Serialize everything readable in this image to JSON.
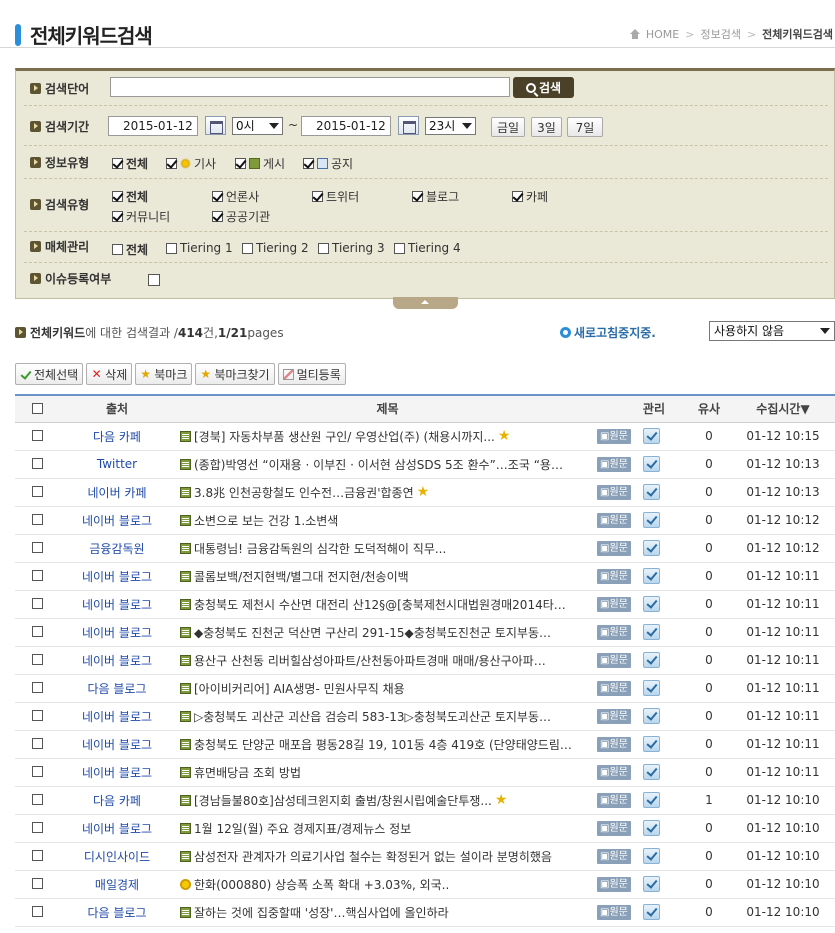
{
  "header": {
    "title": "전체키워드검색",
    "breadcrumb": [
      "HOME",
      "정보검색",
      "전체키워드검색"
    ]
  },
  "search": {
    "keyword_label": "검색단어",
    "keyword_value": "",
    "search_button": "검색",
    "period_label": "검색기간",
    "date_from": "2015-01-12",
    "hour_from": "0시",
    "tilde": "~",
    "date_to": "2015-01-12",
    "hour_to": "23시",
    "quick_buttons": [
      "금일",
      "3일",
      "7일"
    ],
    "info_type_label": "정보유형",
    "info_types": [
      {
        "label": "전체",
        "checked": true,
        "icon": "none"
      },
      {
        "label": "기사",
        "checked": true,
        "icon": "sun-icon"
      },
      {
        "label": "게시",
        "checked": true,
        "icon": "post-icon"
      },
      {
        "label": "공지",
        "checked": true,
        "icon": "notice-icon"
      }
    ],
    "search_type_label": "검색유형",
    "search_types": [
      {
        "label": "전체",
        "checked": true
      },
      {
        "label": "언론사",
        "checked": true
      },
      {
        "label": "트위터",
        "checked": true
      },
      {
        "label": "블로그",
        "checked": true
      },
      {
        "label": "카페",
        "checked": true
      },
      {
        "label": "커뮤니티",
        "checked": true
      },
      {
        "label": "공공기관",
        "checked": true
      }
    ],
    "media_label": "매체관리",
    "media_types": [
      {
        "label": "전체",
        "checked": false
      },
      {
        "label": "Tiering 1",
        "checked": false
      },
      {
        "label": "Tiering 2",
        "checked": false
      },
      {
        "label": "Tiering 3",
        "checked": false
      },
      {
        "label": "Tiering 4",
        "checked": false
      }
    ],
    "issue_label": "이슈등록여부",
    "issue_checked": false
  },
  "results": {
    "prefix": "전체키워드",
    "middle": "에 대한 검색결과 / ",
    "count": "414",
    "count_unit": " 건, ",
    "page": "1/21",
    "page_unit": " pages",
    "refresh_label": "새로고침중지중.",
    "refresh_option": "사용하지 않음"
  },
  "toolbar": {
    "select_all": "전체선택",
    "delete": "삭제",
    "bookmark": "북마크",
    "find_bookmark": "북마크찾기",
    "multi_register": "멀티등록"
  },
  "table": {
    "headers": {
      "source": "출처",
      "title": "제목",
      "manage": "관리",
      "similar": "유사",
      "time": "수집시간▼"
    },
    "original_label": "원문",
    "rows": [
      {
        "source": "다음 카페",
        "title": "[경북] 자동차부품 생산원 구인/ 우영산업(주) (채용시까지...",
        "icon": "post",
        "star": true,
        "similar": "0",
        "time": "01-12 10:15"
      },
      {
        "source": "Twitter",
        "title": "(종합)박영선 “이재용 · 이부진 · 이서현 삼성SDS 5조 환수”…조국 “용…",
        "icon": "post",
        "star": false,
        "similar": "0",
        "time": "01-12 10:13"
      },
      {
        "source": "네이버 카페",
        "title": "3.8兆 인천공항철도 인수전…금융권'합종연",
        "icon": "post",
        "star": true,
        "similar": "0",
        "time": "01-12 10:13"
      },
      {
        "source": "네이버 블로그",
        "title": "소변으로 보는 건강 1.소변색",
        "icon": "post",
        "star": false,
        "similar": "0",
        "time": "01-12 10:12"
      },
      {
        "source": "금융감독원",
        "title": "대통령님! 금융감독원의 심각한 도덕적해이 직무...",
        "icon": "post",
        "star": false,
        "similar": "0",
        "time": "01-12 10:12"
      },
      {
        "source": "네이버 블로그",
        "title": "콜롬보백/전지현백/별그대 전지현/천송이백",
        "icon": "post",
        "star": false,
        "similar": "0",
        "time": "01-12 10:11"
      },
      {
        "source": "네이버 블로그",
        "title": "충청북도 제천시 수산면 대전리 산12§@[충북제천시대법원경매2014타…",
        "icon": "post",
        "star": false,
        "similar": "0",
        "time": "01-12 10:11"
      },
      {
        "source": "네이버 블로그",
        "title": "◆충청북도 진천군 덕산면 구산리 291-15◆충청북도진천군 토지부동…",
        "icon": "post",
        "star": false,
        "similar": "0",
        "time": "01-12 10:11"
      },
      {
        "source": "네이버 블로그",
        "title": "용산구 산천동 리버힐삼성아파트/산천동아파트경매 매매/용산구아파…",
        "icon": "post",
        "star": false,
        "similar": "0",
        "time": "01-12 10:11"
      },
      {
        "source": "다음 블로그",
        "title": "[아이비커리어] AIA생명- 민원사무직 채용",
        "icon": "post",
        "star": false,
        "similar": "0",
        "time": "01-12 10:11"
      },
      {
        "source": "네이버 블로그",
        "title": "▷충청북도 괴산군 괴산읍 검승리 583-13▷충청북도괴산군 토지부동…",
        "icon": "post",
        "star": false,
        "similar": "0",
        "time": "01-12 10:11"
      },
      {
        "source": "네이버 블로그",
        "title": "충청북도 단양군 매포읍 평동28길 19, 101동 4층 419호 (단양태양드림…",
        "icon": "post",
        "star": false,
        "similar": "0",
        "time": "01-12 10:11"
      },
      {
        "source": "네이버 블로그",
        "title": "휴면배당금 조회 방법",
        "icon": "post",
        "star": false,
        "similar": "0",
        "time": "01-12 10:11"
      },
      {
        "source": "다음 카페",
        "title": "[경남들불80호]삼성테크윈지회 출범/창원시립예술단투쟁...",
        "icon": "post",
        "star": true,
        "similar": "1",
        "time": "01-12 10:10"
      },
      {
        "source": "네이버 블로그",
        "title": "1월 12일(월) 주요 경제지표/경제뉴스 정보",
        "icon": "post",
        "star": false,
        "similar": "0",
        "time": "01-12 10:10"
      },
      {
        "source": "디시인사이드",
        "title": "삼성전자 관계자가 의료기사업 철수는 확정된거 없는 설이라 분명히했음",
        "icon": "post",
        "star": false,
        "similar": "0",
        "time": "01-12 10:10"
      },
      {
        "source": "매일경제",
        "title": "한화(000880) 상승폭 소폭 확대 +3.03%, 외국..",
        "icon": "news",
        "star": false,
        "similar": "0",
        "time": "01-12 10:10"
      },
      {
        "source": "다음 블로그",
        "title": "잘하는 것에 집중할때 '성장'…핵심사업에 올인하라",
        "icon": "post",
        "star": false,
        "similar": "0",
        "time": "01-12 10:10"
      }
    ]
  }
}
